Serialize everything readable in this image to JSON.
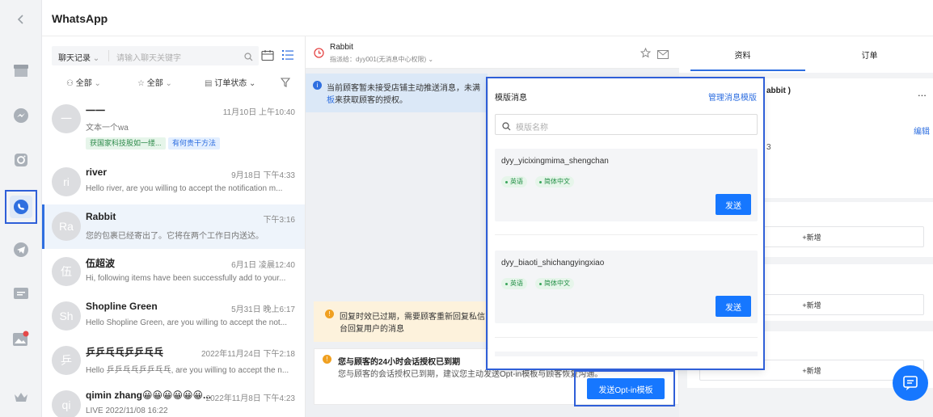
{
  "app": {
    "title": "WhatsApp"
  },
  "filters": {
    "record_select": "聊天记录",
    "search_placeholder": "请输入聊天关键字",
    "all1": "全部",
    "all2": "全部",
    "order_status": "订单状态"
  },
  "chats": [
    {
      "avatar": "一",
      "name": "一一",
      "time": "11月10日 上午10:40",
      "preview": "文本一个wa",
      "tags": [
        "获国家科技股如一缕...",
        "有何贵干方法"
      ]
    },
    {
      "avatar": "ri",
      "name": "river",
      "time": "9月18日 下午4:33",
      "preview": "Hello river, are you willing to accept the notification m..."
    },
    {
      "avatar": "Ra",
      "name": "Rabbit",
      "time": "下午3:16",
      "preview": "您的包裹已经寄出了。它将在两个工作日内送达。"
    },
    {
      "avatar": "伍",
      "name": "伍超波",
      "time": "6月1日 凌晨12:40",
      "preview": "Hi, following items have been successfully add to your..."
    },
    {
      "avatar": "Sh",
      "name": "Shopline Green",
      "time": "5月31日 晚上6:17",
      "preview": "Hello Shopline Green, are you willing to accept the not..."
    },
    {
      "avatar": "乒",
      "name": "乒乒乓乓乒乒乓乓",
      "time": "2022年11月24日 下午2:18",
      "preview": "Hello 乒乒乓乓乒乒乓乓, are you willing to accept the n..."
    },
    {
      "avatar": "qi",
      "name": "qimin zhang😀😀😀😀😀😀...",
      "time": "2022年11月8日 下午4:23",
      "preview": "LIVE 2022/11/08 16:22"
    }
  ],
  "chat_header": {
    "name": "Rabbit",
    "assign": "指派给：dyy001(无消息中心权限)"
  },
  "notice": {
    "line1": "当前顾客暂未接受店铺主动推送消息，未满",
    "line2_link": "板",
    "line2": "来获取顾客的授权。"
  },
  "expired_notice": {
    "line1": "回复时效已过期，需要顾客重新回复私信",
    "line2": "台回复用户的消息"
  },
  "auth_expired": {
    "title": "您与顾客的24小时会话授权已到期",
    "desc": "您与顾客的会话授权已到期，建议您主动发送Opt-in模板与顾客恢复沟通。"
  },
  "opt_button": "发送Opt-in模板",
  "info_tabs": {
    "profile": "资料",
    "orders": "订单"
  },
  "info": {
    "name_fragment": "abbit )",
    "edit": "编辑",
    "number_fragment": "3",
    "more": "...",
    "add1": "+新增",
    "add2": "+新增",
    "add3": "+新增"
  },
  "template_popup": {
    "title": "模版消息",
    "manage_link": "管理消息模版",
    "search_placeholder": "模版名称",
    "templates": [
      {
        "name": "dyy_yicixingmima_shengchan",
        "langs": [
          "英语",
          "简体中文"
        ],
        "send": "发送"
      },
      {
        "name": "dyy_biaoti_shichangyingxiao",
        "langs": [
          "英语",
          "简体中文"
        ],
        "send": "发送"
      }
    ]
  },
  "colors": {
    "accent": "#1677ff",
    "highlight": "#2f5fd8",
    "warning": "#f0a020",
    "info_bg": "#dbe8f7"
  }
}
